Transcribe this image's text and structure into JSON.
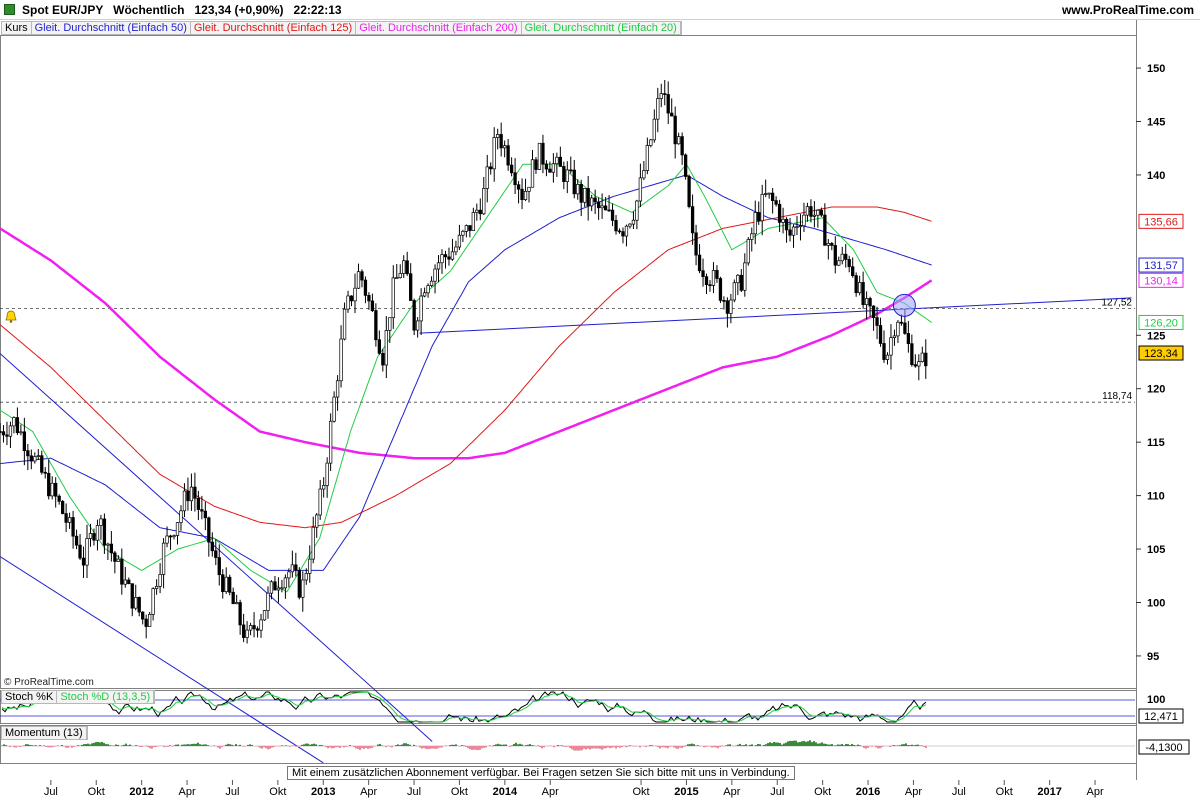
{
  "header": {
    "title": "Spot EUR/JPY   Wöchentlich   123,34 (+0,90%)   22:22:13",
    "site": "www.ProRealTime.com"
  },
  "legend": {
    "kurs": "Kurs",
    "ma50": "Gleit. Durchschnitt (Einfach 50)",
    "ma125": "Gleit. Durchschnitt (Einfach 125)",
    "ma200": "Gleit. Durchschnitt (Einfach 200)",
    "ma20": "Gleit. Durchschnitt (Einfach 20)"
  },
  "colors": {
    "ma50": "#1f1fd0",
    "ma125": "#e01818",
    "ma200": "#f020f0",
    "ma20": "#22cc44",
    "price_tag": "#ffcc00"
  },
  "chart_data": {
    "type": "candlestick",
    "instrument": "Spot EUR/JPY",
    "timeframe": "Wöchentlich",
    "last": "123,34",
    "change": "+0,90%",
    "time": "22:22:13",
    "ylim": [
      92,
      153
    ],
    "y_ticks": [
      95,
      100,
      105,
      110,
      115,
      120,
      125,
      140,
      145,
      150
    ],
    "x_ticks": [
      {
        "t": 2011.5,
        "label": "Jul"
      },
      {
        "t": 2011.75,
        "label": "Okt"
      },
      {
        "t": 2012.0,
        "label": "2012"
      },
      {
        "t": 2012.25,
        "label": "Apr"
      },
      {
        "t": 2012.5,
        "label": "Jul"
      },
      {
        "t": 2012.75,
        "label": "Okt"
      },
      {
        "t": 2013.0,
        "label": "2013"
      },
      {
        "t": 2013.25,
        "label": "Apr"
      },
      {
        "t": 2013.5,
        "label": "Jul"
      },
      {
        "t": 2013.75,
        "label": "Okt"
      },
      {
        "t": 2014.0,
        "label": "2014"
      },
      {
        "t": 2014.25,
        "label": "Apr"
      },
      {
        "t": 2014.75,
        "label": "Okt"
      },
      {
        "t": 2015.0,
        "label": "2015"
      },
      {
        "t": 2015.25,
        "label": "Apr"
      },
      {
        "t": 2015.5,
        "label": "Jul"
      },
      {
        "t": 2015.75,
        "label": "Okt"
      },
      {
        "t": 2016.0,
        "label": "2016"
      },
      {
        "t": 2016.25,
        "label": "Apr"
      },
      {
        "t": 2016.5,
        "label": "Jul"
      },
      {
        "t": 2016.75,
        "label": "Okt"
      },
      {
        "t": 2017.0,
        "label": "2017"
      },
      {
        "t": 2017.25,
        "label": "Apr"
      }
    ],
    "bold_years": [
      "2012",
      "2013",
      "2014",
      "2015",
      "2016",
      "2017"
    ],
    "price_path": [
      [
        2011.22,
        116
      ],
      [
        2011.3,
        117
      ],
      [
        2011.42,
        113
      ],
      [
        2011.55,
        109
      ],
      [
        2011.68,
        104
      ],
      [
        2011.76,
        108
      ],
      [
        2011.85,
        104
      ],
      [
        2011.93,
        101
      ],
      [
        2012.02,
        98
      ],
      [
        2012.12,
        105
      ],
      [
        2012.2,
        108
      ],
      [
        2012.27,
        111
      ],
      [
        2012.33,
        108
      ],
      [
        2012.42,
        103
      ],
      [
        2012.5,
        100
      ],
      [
        2012.58,
        96.5
      ],
      [
        2012.66,
        99
      ],
      [
        2012.74,
        102
      ],
      [
        2012.82,
        103
      ],
      [
        2012.88,
        101
      ],
      [
        2012.94,
        106
      ],
      [
        2013.0,
        111
      ],
      [
        2013.06,
        119
      ],
      [
        2013.12,
        127
      ],
      [
        2013.2,
        131
      ],
      [
        2013.27,
        127
      ],
      [
        2013.33,
        123
      ],
      [
        2013.38,
        129
      ],
      [
        2013.44,
        132
      ],
      [
        2013.5,
        126
      ],
      [
        2013.56,
        130
      ],
      [
        2013.64,
        132
      ],
      [
        2013.72,
        133
      ],
      [
        2013.8,
        135
      ],
      [
        2013.88,
        138
      ],
      [
        2013.96,
        144
      ],
      [
        2014.04,
        141
      ],
      [
        2014.1,
        138
      ],
      [
        2014.18,
        142
      ],
      [
        2014.26,
        141
      ],
      [
        2014.34,
        140
      ],
      [
        2014.42,
        138
      ],
      [
        2014.5,
        137
      ],
      [
        2014.58,
        136
      ],
      [
        2014.65,
        135
      ],
      [
        2014.72,
        137
      ],
      [
        2014.8,
        143
      ],
      [
        2014.86,
        148
      ],
      [
        2014.92,
        145
      ],
      [
        2014.98,
        141
      ],
      [
        2015.04,
        133
      ],
      [
        2015.1,
        131
      ],
      [
        2015.16,
        130
      ],
      [
        2015.22,
        128
      ],
      [
        2015.3,
        130
      ],
      [
        2015.38,
        136
      ],
      [
        2015.44,
        138
      ],
      [
        2015.5,
        137
      ],
      [
        2015.56,
        134
      ],
      [
        2015.62,
        136
      ],
      [
        2015.68,
        137
      ],
      [
        2015.75,
        135
      ],
      [
        2015.82,
        132
      ],
      [
        2015.9,
        132
      ],
      [
        2015.97,
        128
      ],
      [
        2016.04,
        126
      ],
      [
        2016.1,
        123
      ],
      [
        2016.16,
        127
      ],
      [
        2016.22,
        124
      ],
      [
        2016.28,
        122
      ],
      [
        2016.33,
        123.34
      ]
    ],
    "ma20": [
      [
        2011.22,
        118
      ],
      [
        2011.4,
        116
      ],
      [
        2011.6,
        110
      ],
      [
        2011.8,
        105
      ],
      [
        2012.0,
        103
      ],
      [
        2012.2,
        105
      ],
      [
        2012.4,
        106
      ],
      [
        2012.6,
        103
      ],
      [
        2012.8,
        101
      ],
      [
        2012.98,
        106
      ],
      [
        2013.15,
        116
      ],
      [
        2013.3,
        123
      ],
      [
        2013.5,
        128
      ],
      [
        2013.7,
        131
      ],
      [
        2013.9,
        136
      ],
      [
        2014.1,
        141
      ],
      [
        2014.3,
        141
      ],
      [
        2014.5,
        138
      ],
      [
        2014.7,
        136.5
      ],
      [
        2014.9,
        139
      ],
      [
        2015.0,
        141
      ],
      [
        2015.1,
        138
      ],
      [
        2015.25,
        133
      ],
      [
        2015.45,
        135
      ],
      [
        2015.6,
        135.5
      ],
      [
        2015.75,
        136
      ],
      [
        2015.92,
        133
      ],
      [
        2016.05,
        129
      ],
      [
        2016.2,
        128
      ],
      [
        2016.35,
        126.2
      ]
    ],
    "ma50": [
      [
        2011.22,
        113
      ],
      [
        2011.5,
        113.5
      ],
      [
        2011.8,
        111
      ],
      [
        2012.1,
        107
      ],
      [
        2012.4,
        106
      ],
      [
        2012.7,
        103
      ],
      [
        2013.0,
        103
      ],
      [
        2013.2,
        108
      ],
      [
        2013.4,
        116
      ],
      [
        2013.6,
        124
      ],
      [
        2013.8,
        130
      ],
      [
        2014.0,
        133
      ],
      [
        2014.3,
        136
      ],
      [
        2014.6,
        138
      ],
      [
        2014.9,
        139.5
      ],
      [
        2015.0,
        140
      ],
      [
        2015.2,
        138
      ],
      [
        2015.45,
        136
      ],
      [
        2015.7,
        135
      ],
      [
        2015.9,
        134
      ],
      [
        2016.1,
        133
      ],
      [
        2016.35,
        131.57
      ]
    ],
    "ma125": [
      [
        2011.22,
        126
      ],
      [
        2011.5,
        122
      ],
      [
        2011.8,
        117
      ],
      [
        2012.1,
        112
      ],
      [
        2012.4,
        109
      ],
      [
        2012.65,
        107.5
      ],
      [
        2012.9,
        107
      ],
      [
        2013.1,
        107.5
      ],
      [
        2013.4,
        110
      ],
      [
        2013.7,
        113
      ],
      [
        2014.0,
        118
      ],
      [
        2014.3,
        124
      ],
      [
        2014.6,
        129
      ],
      [
        2014.9,
        133
      ],
      [
        2015.2,
        135
      ],
      [
        2015.5,
        136
      ],
      [
        2015.8,
        137
      ],
      [
        2016.05,
        137
      ],
      [
        2016.2,
        136.5
      ],
      [
        2016.35,
        135.66
      ]
    ],
    "ma200": [
      [
        2011.22,
        135
      ],
      [
        2011.5,
        132
      ],
      [
        2011.8,
        128
      ],
      [
        2012.1,
        123
      ],
      [
        2012.4,
        119
      ],
      [
        2012.65,
        116
      ],
      [
        2012.9,
        115
      ],
      [
        2013.2,
        114
      ],
      [
        2013.5,
        113.5
      ],
      [
        2013.8,
        113.5
      ],
      [
        2014.0,
        114
      ],
      [
        2014.3,
        116
      ],
      [
        2014.6,
        118
      ],
      [
        2014.9,
        120
      ],
      [
        2015.2,
        122
      ],
      [
        2015.5,
        123
      ],
      [
        2015.8,
        125
      ],
      [
        2016.05,
        127
      ],
      [
        2016.2,
        128.5
      ],
      [
        2016.35,
        130.14
      ]
    ],
    "trendlines": [
      {
        "from": [
          2011.22,
          123.3
        ],
        "to": [
          2013.6,
          87
        ]
      },
      {
        "from": [
          2011.22,
          104.3
        ],
        "to": [
          2013.0,
          85
        ]
      },
      {
        "from": [
          2013.53,
          125.2
        ],
        "to": [
          2017.45,
          128.5
        ]
      }
    ],
    "hlines": [
      {
        "value": 127.52,
        "label": "127,52"
      },
      {
        "value": 118.74,
        "label": "118,74"
      }
    ],
    "highlight_circle": {
      "t": 2016.2,
      "y": 127.8
    },
    "price_labels": [
      {
        "value": 135.66,
        "text": "135,66",
        "color": "#e01818"
      },
      {
        "value": 131.57,
        "text": "131,57",
        "color": "#1f1fd0"
      },
      {
        "value": 130.14,
        "text": "130,14",
        "color": "#f020f0"
      },
      {
        "value": 126.2,
        "text": "126,20",
        "color": "#22cc44"
      },
      {
        "value": 123.34,
        "text": "123,34",
        "color": "#000000",
        "bg": "#ffcc00"
      }
    ],
    "stoch": {
      "label1": "Stoch %K",
      "label2": "Stoch %D (13,3,5)",
      "axis_top": "100",
      "value": "12,471"
    },
    "momentum": {
      "label": "Momentum (13)",
      "value": "-4,1300"
    }
  },
  "footer": {
    "copyright": "© ProRealTime.com",
    "notice": "Mit einem zusätzlichen Abonnement verfügbar. Bei Fragen setzen Sie sich bitte mit uns in Verbindung."
  }
}
